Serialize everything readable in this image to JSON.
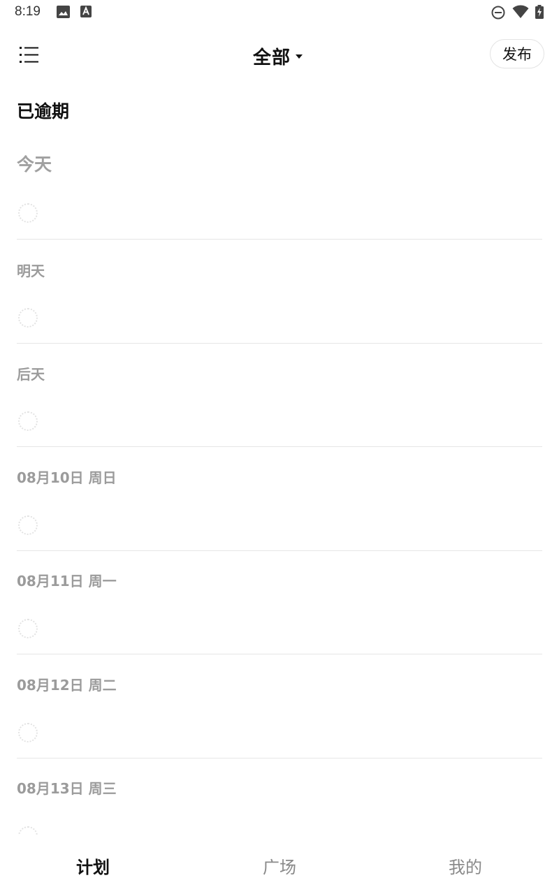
{
  "status_bar": {
    "time": "8:19",
    "icons": [
      "image-icon",
      "text-a-icon",
      "do-not-disturb-icon",
      "wifi-icon",
      "battery-charging-icon"
    ]
  },
  "header": {
    "menu_icon": "list-menu-icon",
    "title": "全部",
    "title_dropdown_icon": "caret-down-icon",
    "publish_label": "发布"
  },
  "overdue_label": "已逾期",
  "sections": [
    {
      "label": "今天"
    },
    {
      "label": "明天"
    },
    {
      "label": "后天"
    },
    {
      "label": "08月10日 周日"
    },
    {
      "label": "08月11日 周一"
    },
    {
      "label": "08月12日 周二"
    },
    {
      "label": "08月13日 周三"
    }
  ],
  "bottom_nav": {
    "items": [
      {
        "label": "计划",
        "active": true
      },
      {
        "label": "广场",
        "active": false
      },
      {
        "label": "我的",
        "active": false
      }
    ]
  },
  "colors": {
    "primary_text": "#111111",
    "muted_text": "#9b9b9b",
    "divider": "#e6e6e6",
    "circle_border": "#e3e3e3"
  }
}
